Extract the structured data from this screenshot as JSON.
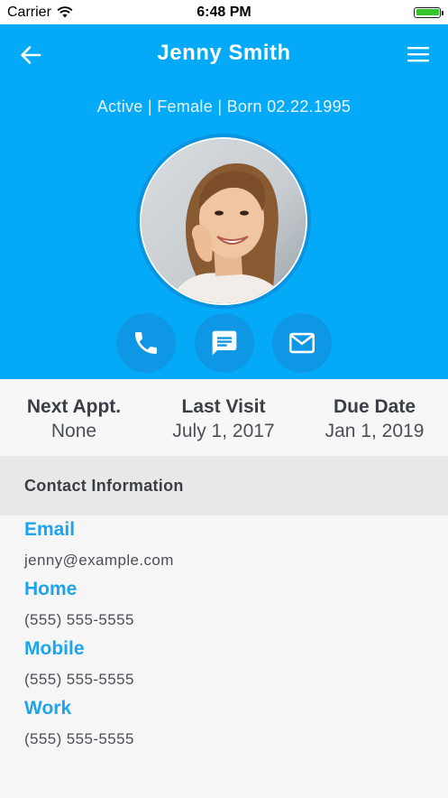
{
  "status_bar": {
    "carrier": "Carrier",
    "time": "6:48 PM",
    "icons": [
      "wifi-icon",
      "battery-icon"
    ]
  },
  "header": {
    "title": "Jenny Smith",
    "subtitle": "Active | Female | Born 02.22.1995",
    "background_color": "#04aaf7",
    "icons": [
      "back-arrow-icon",
      "hamburger-menu-icon"
    ]
  },
  "actions": {
    "icons": [
      "phone-icon",
      "message-icon",
      "mail-icon"
    ]
  },
  "stats": [
    {
      "label": "Next Appt.",
      "value": "None"
    },
    {
      "label": "Last Visit",
      "value": "July 1, 2017"
    },
    {
      "label": "Due Date",
      "value": "Jan 1, 2019"
    }
  ],
  "contact_section": {
    "title": "Contact Information",
    "items": [
      {
        "label": "Email",
        "value": "jenny@example.com"
      },
      {
        "label": "Home",
        "value": "(555) 555-5555"
      },
      {
        "label": "Mobile",
        "value": "(555) 555-5555"
      },
      {
        "label": "Work",
        "value": "(555) 555-5555"
      }
    ],
    "label_color": "#1ba5ee"
  }
}
